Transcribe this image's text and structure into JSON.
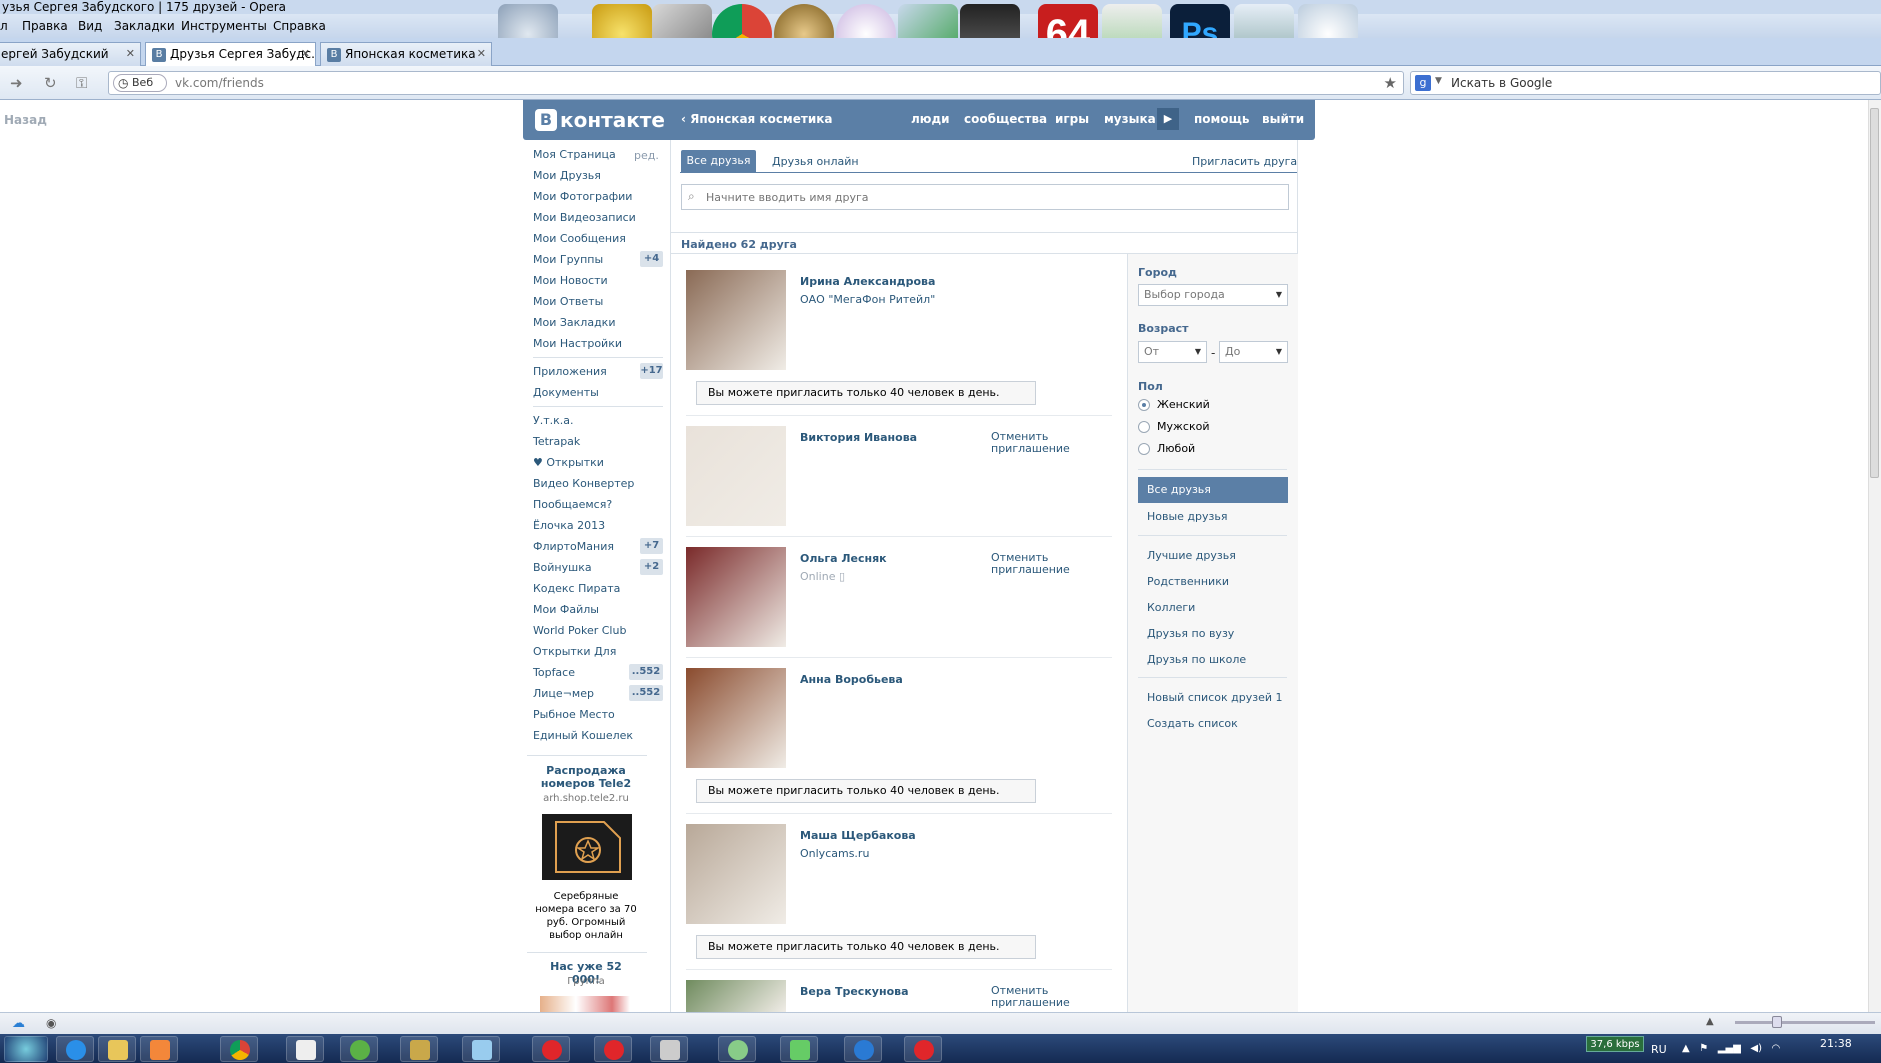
{
  "window": {
    "title": "узья Сергея Забудского | 175 друзей - Opera"
  },
  "menu": [
    "л",
    "Правка",
    "Вид",
    "Закладки",
    "Инструменты",
    "Справка"
  ],
  "tabs": [
    {
      "label": "ергей Забудский"
    },
    {
      "label": "Друзья Сергея Забудс...",
      "active": true
    },
    {
      "label": "Японская косметика"
    }
  ],
  "address": {
    "web_label": "Веб",
    "domain": "vk.com",
    "path": "/friends"
  },
  "search_engine": {
    "placeholder": "Искать в Google"
  },
  "page": {
    "back_label": "Назад",
    "header": {
      "logo": "контакте",
      "logo_letter": "В",
      "back_link": "Японская косметика",
      "nav": [
        "люди",
        "сообщества",
        "игры",
        "музыка",
        "помощь",
        "выйти"
      ]
    },
    "left_menu": {
      "edit": "ред.",
      "items": [
        "Моя Страница",
        "Мои Друзья",
        "Мои Фотографии",
        "Мои Видеозаписи",
        "Мои Сообщения",
        "Мои Группы",
        "Мои Новости",
        "Мои Ответы",
        "Мои Закладки",
        "Мои Настройки"
      ],
      "groups_count": "+4",
      "apps": [
        "Приложения",
        "Документы"
      ],
      "apps_count": "+17",
      "apps2": [
        "У.т.к.а.",
        "Tetrapak",
        "♥ Открытки",
        "Видео Конвертер",
        "Пообщаемся?",
        "Ёлочка 2013",
        "ФлиртоМания",
        "Войнушка",
        "Кодекс Пирата",
        "Мои Файлы",
        "World Poker Club",
        "Открытки Для",
        "Topface",
        "Лице¬мер",
        "Рыбное Место",
        "Единый Кошелек"
      ],
      "counts2": {
        "flirt": "+7",
        "voin": "+2",
        "topface": "..552",
        "litsemer": "..552"
      }
    },
    "ads": [
      {
        "title": "Распродажа номеров Tele2",
        "sub": "arh.shop.tele2.ru",
        "text": "Серебряные номера всего за 70 руб. Огромный выбор онлайн"
      },
      {
        "title": "Нас уже 52 000!",
        "sub": "Группа"
      }
    ],
    "tabs": {
      "all": "Все друзья",
      "online": "Друзья онлайн",
      "invite": "Пригласить друга"
    },
    "search_placeholder": "Начните вводить имя друга",
    "found": "Найдено 62 друга",
    "friends": [
      {
        "name": "Ирина Александрова",
        "info": "ОАО \"МегаФон Ритейл\"",
        "limit": "Вы можете пригласить только 40 человек в день.",
        "photo": "#8a6a55"
      },
      {
        "name": "Виктория Иванова",
        "cancel": "Отменить приглашение",
        "photo": "#e9e2da"
      },
      {
        "name": "Ольга Лесняк",
        "online": "Online",
        "cancel": "Отменить приглашение",
        "photo": "#7a2a2a"
      },
      {
        "name": "Анна Воробьева",
        "limit": "Вы можете пригласить только 40 человек в день.",
        "photo": "#8a4b2e"
      },
      {
        "name": "Маша Щербакова",
        "info": "Onlycams.ru",
        "limit": "Вы можете пригласить только 40 человек в день.",
        "photo": "#b8a898"
      },
      {
        "name": "Вера Трескунова",
        "cancel": "Отменить приглашение",
        "photo": "#6f8b5e"
      }
    ],
    "filter": {
      "city_label": "Город",
      "city_placeholder": "Выбор города",
      "age_label": "Возраст",
      "age_from": "От",
      "age_to": "До",
      "dash": "-",
      "sex_label": "Пол",
      "sex_options": [
        "Женский",
        "Мужской",
        "Любой"
      ],
      "sex_selected": "Женский",
      "lists": [
        "Все друзья",
        "Новые друзья"
      ],
      "lists2": [
        "Лучшие друзья",
        "Родственники",
        "Коллеги",
        "Друзья по вузу",
        "Друзья по школе"
      ],
      "lists3": [
        "Новый список друзей 1",
        "Создать список"
      ]
    }
  },
  "taskbar": {
    "kbps": "37,6 kbps",
    "lang": "RU",
    "time": "21:38"
  },
  "colors": {
    "vk_blue": "#5b7fa6",
    "link": "#2b587a",
    "taskbar": "#1c3564"
  }
}
